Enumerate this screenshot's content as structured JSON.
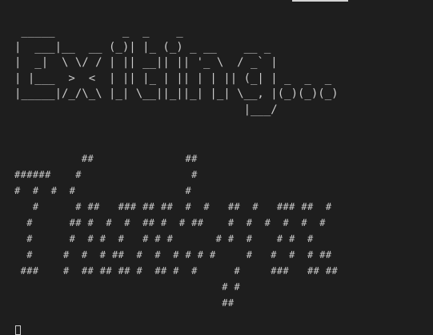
{
  "terminal": {
    "exiting_banner": " _____          _  _    _\n|  ___|__  __ (_)| |_ (_) _ __    __ _\n|  _|  \\ \\/ / | || __|| || '_ \\  / _` |\n| |___  >  <  | || |_ | || | | || (_| | _  _  _\n|_____|/_/\\_\\ |_| \\__||_||_| |_| \\__, |(_)(_)(_)\n                                  |___/",
    "hash_art": "           ##               ##\n######    #                  #\n#  #  #  #                  #\n   #      # ##   ### ## ##  #  #   ##  #   ### ##  #\n  #      ## #  #  #  ## #  # ##    #  #  #  #  #  #\n  #      #  # #  #   # # #       # #  #    # #  #\n  #     #  #  # ##  #  #  # # # #     #   #  #  # ##\n ###    #  ## ## ## #  ## #  #      #     ###   ## ##\n                                  # #\n                                  ##",
    "cursor_glyph": ""
  }
}
